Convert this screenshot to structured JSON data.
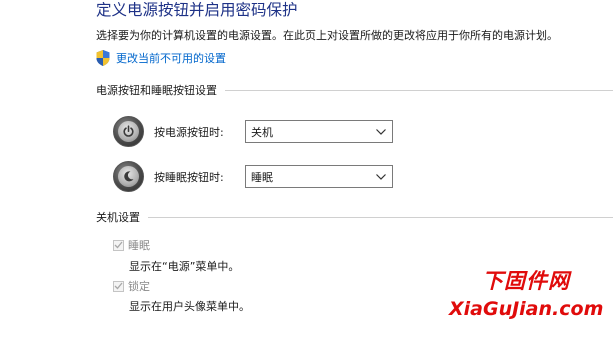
{
  "header": {
    "title": "定义电源按钮并启用密码保护",
    "subtitle": "选择要为你的计算机设置的电源设置。在此页上对设置所做的更改将应用于你所有的电源计划。",
    "change_link": "更改当前不可用的设置"
  },
  "power_buttons_section": {
    "title": "电源按钮和睡眠按钮设置",
    "power_button": {
      "label": "按电源按钮时:",
      "value": "关机"
    },
    "sleep_button": {
      "label": "按睡眠按钮时:",
      "value": "睡眠"
    }
  },
  "shutdown_section": {
    "title": "关机设置",
    "items": [
      {
        "label": "睡眠",
        "description": "显示在“电源”菜单中。",
        "checked": true,
        "disabled": true
      },
      {
        "label": "锁定",
        "description": "显示在用户头像菜单中。",
        "checked": true,
        "disabled": true
      }
    ]
  },
  "watermark": {
    "cn": "下固件网",
    "en": "XiaGuJian.com"
  },
  "colors": {
    "title": "#1e3287",
    "link": "#0066cc",
    "watermark": "#e00b0b"
  },
  "icons": [
    "uac-shield-icon",
    "power-button-icon",
    "sleep-button-icon",
    "chevron-down-icon",
    "checkmark-icon"
  ]
}
